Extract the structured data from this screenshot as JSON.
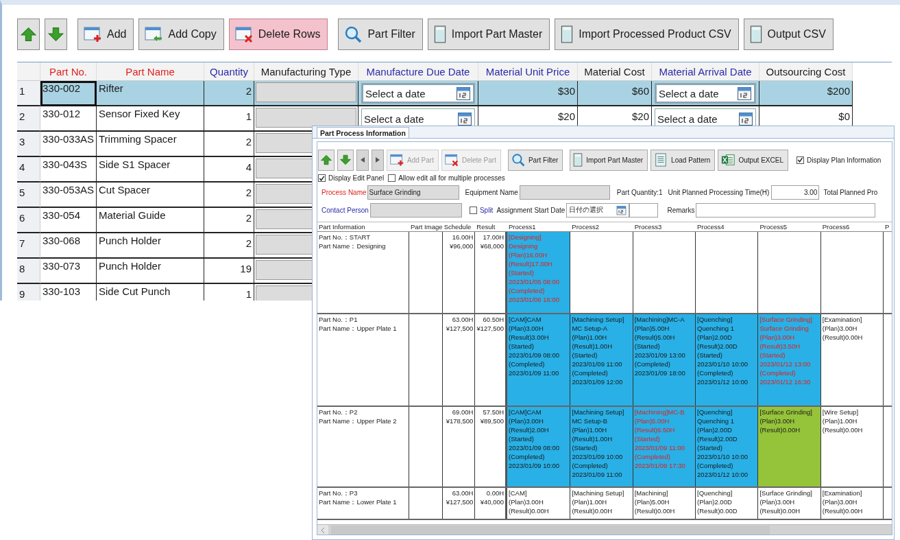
{
  "main": {
    "toolbar": [
      {
        "kind": "up",
        "highlighted": false
      },
      {
        "kind": "down",
        "highlighted": false
      },
      {
        "kind": "add",
        "label": "Add",
        "highlighted": false
      },
      {
        "kind": "copy",
        "label": "Add Copy",
        "highlighted": false
      },
      {
        "kind": "delete",
        "label": "Delete Rows",
        "highlighted": true
      },
      {
        "kind": "filter",
        "label": "Part Filter",
        "highlighted": false
      },
      {
        "kind": "import",
        "label": "Import Part Master",
        "highlighted": false
      },
      {
        "kind": "import",
        "label": "Import Processed Product CSV",
        "highlighted": false
      },
      {
        "kind": "import",
        "label": "Output CSV",
        "highlighted": false
      }
    ],
    "table": {
      "columns": [
        {
          "label": "Part No.",
          "color": "#e0201c"
        },
        {
          "label": "Part Name",
          "color": "#e0201c"
        },
        {
          "label": "Quantity",
          "color": "#2a2aa8"
        },
        {
          "label": "Manufacturing Type",
          "color": "#1a1a1a"
        },
        {
          "label": "Manufacture Due Date",
          "color": "#2a2aa8"
        },
        {
          "label": "Material Unit Price",
          "color": "#2a2aa8"
        },
        {
          "label": "Material Cost",
          "color": "#1a1a1a"
        },
        {
          "label": "Material Arrival Date",
          "color": "#2a2aa8"
        },
        {
          "label": "Outsourcing Cost",
          "color": "#1a1a1a"
        }
      ],
      "rows": [
        {
          "number": "1",
          "selected": true,
          "focused": true,
          "part_no": "330-002",
          "part_name": "Rifter",
          "quantity": "2",
          "due_date": {
            "placeholder": "Select a date"
          },
          "unit_price": "$30",
          "cost": "$60",
          "arrival_date": {
            "placeholder": "Select a date"
          },
          "outsourcing_cost": "$200"
        },
        {
          "number": "2",
          "selected": false,
          "focused": false,
          "part_no": "330-012",
          "part_name": "Sensor Fixed Key",
          "quantity": "1",
          "due_date": {
            "placeholder": "Select a date"
          },
          "unit_price": "$20",
          "cost": "$20",
          "arrival_date": {
            "placeholder": "Select a date"
          },
          "outsourcing_cost": "$0"
        },
        {
          "number": "3",
          "selected": false,
          "focused": false,
          "part_no": "330-033AS",
          "part_name": "Trimming Spacer",
          "quantity": "2"
        },
        {
          "number": "4",
          "selected": false,
          "focused": false,
          "part_no": "330-043S",
          "part_name": "Side S1 Spacer",
          "quantity": "4"
        },
        {
          "number": "5",
          "selected": false,
          "focused": false,
          "part_no": "330-053AS",
          "part_name": "Cut Spacer",
          "quantity": "2"
        },
        {
          "number": "6",
          "selected": false,
          "focused": false,
          "part_no": "330-054",
          "part_name": "Material Guide",
          "quantity": "2"
        },
        {
          "number": "7",
          "selected": false,
          "focused": false,
          "part_no": "330-068",
          "part_name": "Punch Holder",
          "quantity": "2"
        },
        {
          "number": "8",
          "selected": false,
          "focused": false,
          "part_no": "330-073",
          "part_name": "Punch Holder",
          "quantity": "19"
        },
        {
          "number": "9",
          "selected": false,
          "focused": false,
          "part_no": "330-103",
          "part_name": "Side Cut Punch",
          "quantity": "1"
        }
      ]
    }
  },
  "process_window": {
    "tab": {
      "label": "Part Process Information",
      "selected": true
    },
    "toolbar": [
      {
        "kind": "up",
        "disabled": false
      },
      {
        "kind": "down",
        "disabled": false
      },
      {
        "kind": "left",
        "disabled": false
      },
      {
        "kind": "right",
        "disabled": false
      },
      {
        "kind": "add",
        "label": "Add Part",
        "disabled": true
      },
      {
        "kind": "delete",
        "label": "Delete Part",
        "disabled": true
      },
      {
        "kind": "filter",
        "label": "Part Filter",
        "disabled": false
      },
      {
        "kind": "import",
        "label": "Import Part Master",
        "disabled": false
      },
      {
        "kind": "pattern",
        "label": "Load Pattern",
        "disabled": false
      },
      {
        "kind": "excel",
        "label": "Output EXCEL",
        "disabled": false
      }
    ],
    "display_plan_information": {
      "label": "Display Plan Information",
      "checked": true
    },
    "options": [
      {
        "label": "Display Edit Panel",
        "checked": true
      },
      {
        "label": "Allow edit all for multiple processes",
        "checked": false
      }
    ],
    "form": {
      "process_name": {
        "label": "Process Name",
        "value": "Surface Grinding"
      },
      "equipment_name": {
        "label": "Equipment Name"
      },
      "part_quantity": "Part Quantity:1",
      "unit_planned_time": {
        "label": "Unit Planned Processing Time(H)",
        "value": "3.00"
      },
      "total_planned": "Total Planned Pro",
      "contact_person": {
        "label": "Contact Person"
      },
      "split": {
        "label": "Split",
        "checked": false
      },
      "assignment_start_date": {
        "label": "Assignment Start Date",
        "placeholder": "日付の選択"
      },
      "remarks": {
        "label": "Remarks"
      }
    },
    "grid": {
      "columns": [
        "Part Information",
        "Part Image",
        "Schedule",
        "Result",
        "Process1",
        "Process2",
        "Process3",
        "Process4",
        "Process5",
        "Process6",
        "P"
      ],
      "rows": [
        {
          "part_info": "Part No.：START\nPart Name：Designing",
          "schedule": "16.00H\n¥96,000",
          "result": "17.00H\n¥68,000",
          "processes": [
            {
              "text": "[Designing]\nDesigning\n(Plan)16.00H\n(Result)17.00H\n(Started)\n2023/01/05 08:00\n(Completed)\n2023/01/06 16:00",
              "color": "#29b0e6",
              "alert": true
            }
          ]
        },
        {
          "part_info": "Part No.：P1\nPart Name：Upper Plate 1",
          "schedule": "63.00H\n¥127,500",
          "result": "60.50H\n¥127,500",
          "processes": [
            {
              "text": "[CAM]CAM\n(Plan)3.00H\n(Result)3.00H\n(Started)\n2023/01/09 08:00\n(Completed)\n2023/01/09 11:00",
              "color": "#29b0e6",
              "alert": false
            },
            {
              "text": "[Machining Setup]\nMC Setup-A\n(Plan)1.00H\n(Result)1.00H\n(Started)\n2023/01/09 11:00\n(Completed)\n2023/01/09 12:00",
              "color": "#29b0e6",
              "alert": false
            },
            {
              "text": "[Machining]MC-A\n(Plan)5.00H\n(Result)5.00H\n(Started)\n2023/01/09 13:00\n(Completed)\n2023/01/09 18:00",
              "color": "#29b0e6",
              "alert": false
            },
            {
              "text": "[Quenching]\nQuenching 1\n(Plan)2.00D\n(Result)2.00D\n(Started)\n2023/01/10 10:00\n(Completed)\n2023/01/12 10:00",
              "color": "#29b0e6",
              "alert": false
            },
            {
              "text": "[Surface Grinding]\nSurface Grinding\n(Plan)3.00H\n(Result)3.50H\n(Started)\n2023/01/12 13:00\n(Completed)\n2023/01/12 16:30",
              "color": "#29b0e6",
              "alert": true
            },
            {
              "text": "[Examination]\n(Plan)3.00H\n(Result)0.00H",
              "color": "#ffffff",
              "alert": false
            }
          ]
        },
        {
          "part_info": "Part No.：P2\nPart Name：Upper Plate 2",
          "schedule": "69.00H\n¥178,500",
          "result": "57.50H\n¥89,500",
          "processes": [
            {
              "text": "[CAM]CAM\n(Plan)3.00H\n(Result)2.00H\n(Started)\n2023/01/09 08:00\n(Completed)\n2023/01/09 10:00",
              "color": "#29b0e6",
              "alert": false
            },
            {
              "text": "[Machining Setup]\nMC Setup-B\n(Plan)1.00H\n(Result)1.00H\n(Started)\n2023/01/09 10:00\n(Completed)\n2023/01/09 11:00",
              "color": "#29b0e6",
              "alert": false
            },
            {
              "text": "[Machining]MC-B\n(Plan)5.00H\n(Result)6.50H\n(Started)\n2023/01/09 11:00\n(Completed)\n2023/01/09 17:30",
              "color": "#29b0e6",
              "alert": true
            },
            {
              "text": "[Quenching]\nQuenching 1\n(Plan)2.00D\n(Result)2.00D\n(Started)\n2023/01/10 10:00\n(Completed)\n2023/01/12 10:00",
              "color": "#29b0e6",
              "alert": false
            },
            {
              "text": "[Surface Grinding]\n(Plan)3.00H\n(Result)0.00H",
              "color": "#95c33a",
              "alert": false
            },
            {
              "text": "[Wire Setup]\n(Plan)1.00H\n(Result)0.00H",
              "color": "#ffffff",
              "alert": false
            }
          ]
        },
        {
          "part_info": "Part No.：P3\nPart Name：Lower Plate 1",
          "schedule": "63.00H\n¥127,500",
          "result": "0.00H\n¥40,000",
          "processes": [
            {
              "text": "[CAM]\n(Plan)3.00H\n(Result)0.00H",
              "color": "#ffffff",
              "alert": false
            },
            {
              "text": "[Machining Setup]\n(Plan)1.00H\n(Result)0.00H",
              "color": "#ffffff",
              "alert": false
            },
            {
              "text": "[Machining]\n(Plan)5.00H\n(Result)0.00H",
              "color": "#ffffff",
              "alert": false
            },
            {
              "text": "[Quenching]\n(Plan)2.00D\n(Result)0.00D",
              "color": "#ffffff",
              "alert": false
            },
            {
              "text": "[Surface Grinding]\n(Plan)3.00H\n(Result)0.00H",
              "color": "#ffffff",
              "alert": false
            },
            {
              "text": "[Examination]\n(Plan)3.00H\n(Result)0.00H",
              "color": "#ffffff",
              "alert": false
            }
          ]
        }
      ]
    }
  }
}
